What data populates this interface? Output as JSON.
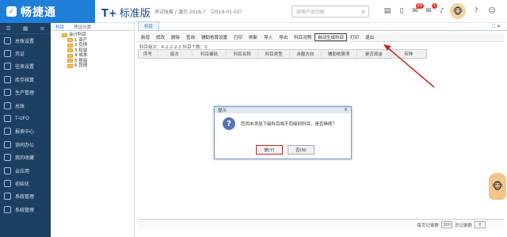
{
  "app": {
    "logo": "畅捷通",
    "edition_prefix": "T+",
    "edition_name": "标准版",
    "company": "测试账套 / 演示 2018-7 （2019-01-02）"
  },
  "search": {
    "placeholder": "搜索产品功能"
  },
  "topicons": [
    {
      "name": "notes-icon",
      "glyph": "▤"
    },
    {
      "name": "phone-icon",
      "glyph": "▯"
    },
    {
      "name": "gift-icon",
      "glyph": "✉",
      "badge": "20"
    },
    {
      "name": "mail-icon",
      "glyph": "✉",
      "badge": "1"
    },
    {
      "name": "bell-icon",
      "glyph": "♪"
    }
  ],
  "sidebar": {
    "items": [
      "总账设置",
      "凭证",
      "往来设置",
      "库存核算",
      "生产管理",
      "总账",
      "T-UFO",
      "报表中心",
      "协同办公",
      "我的收藏",
      "云应用",
      "初始化",
      "系统管理",
      "系统管理"
    ]
  },
  "leftpanel": {
    "tabs": [
      "科目",
      "凭证分类"
    ],
    "tree": {
      "root": "会计科目",
      "children": [
        "1 资产",
        "2 负债",
        "3 权益",
        "4 成本",
        "5 损益",
        "6 其他"
      ]
    }
  },
  "doc": {
    "tab": "科目"
  },
  "toolbar": {
    "items": [
      "新增",
      "修改",
      "删除",
      "查询",
      "辅助核算设置",
      "打印",
      "刷新",
      "导入",
      "导出",
      "科目对照",
      "自动生成科目",
      "打印",
      "退出"
    ],
    "highlighted": 10
  },
  "filter": {
    "text": "科目级次：4-2-2-2-2 科目个数：0"
  },
  "grid": {
    "columns": [
      "序号",
      "级次",
      "科目编码",
      "科目名称",
      "科目类型",
      "余额方向",
      "辅助核算项",
      "是否现金",
      "币种"
    ]
  },
  "statusbar": {
    "page_label": "每页记录数",
    "page_size": "200",
    "total_label": "总记录数",
    "total": "0"
  },
  "dialog": {
    "title": "提示",
    "message": "您尚未添加下级科目或不同级别科目，是否继续？",
    "yes": "是(Y)",
    "no": "否(N)"
  },
  "colors": {
    "accent": "#1f7fd8",
    "sidebar": "#1d3f62",
    "arrow": "#c62828"
  }
}
